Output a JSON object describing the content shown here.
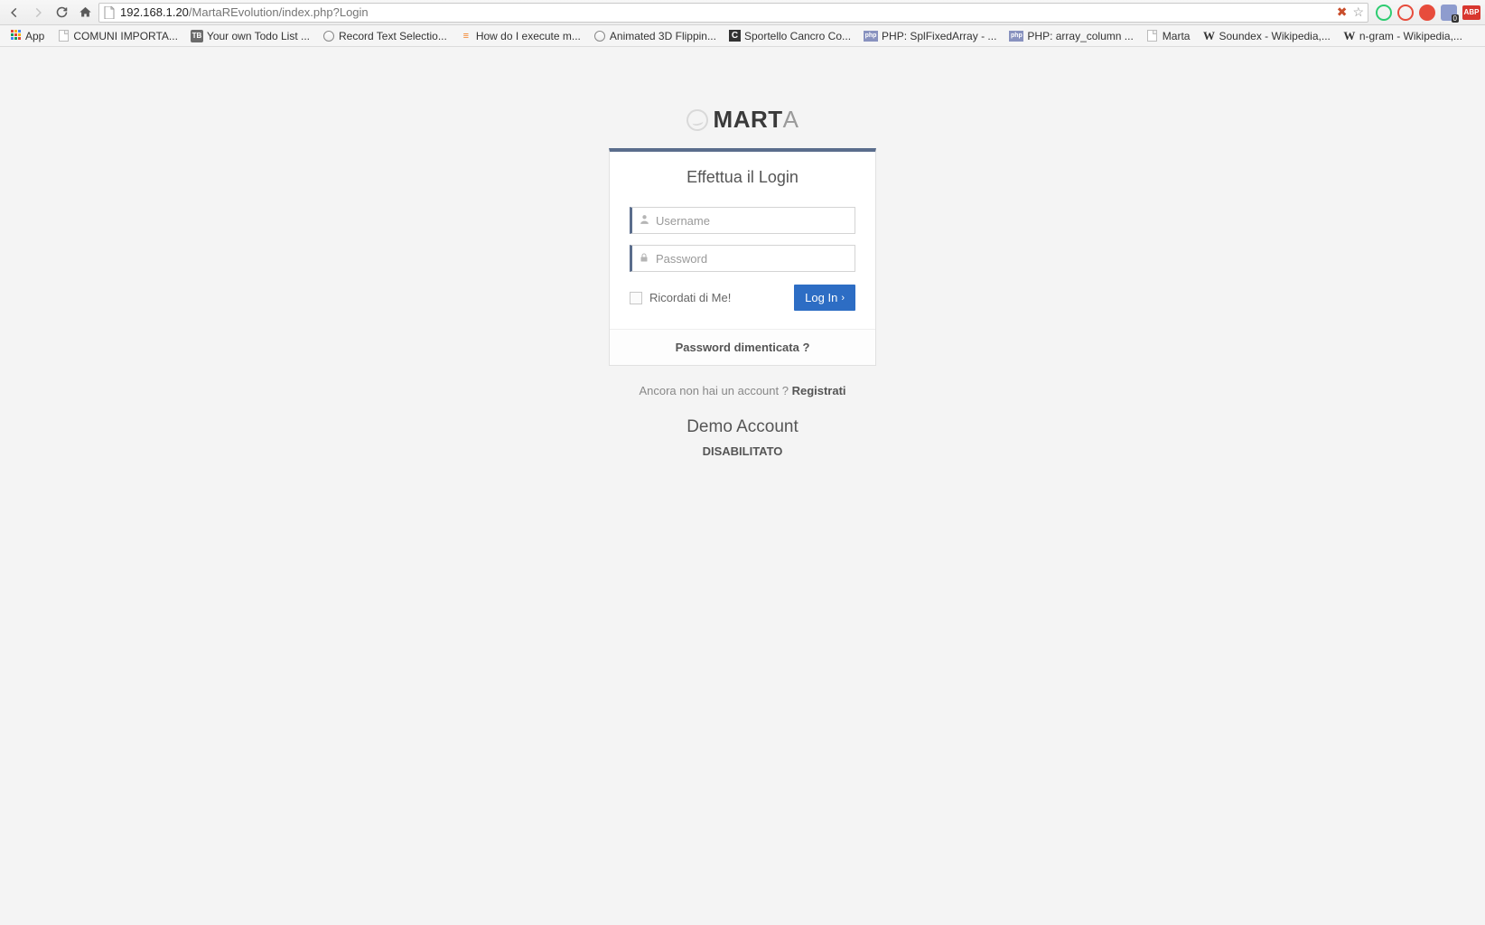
{
  "browser": {
    "url_host": "192.168.1.20",
    "url_path": "/MartaREvolution/index.php?Login"
  },
  "bookmarks": {
    "apps": "App",
    "items": [
      "COMUNI IMPORTA...",
      "Your own Todo List ...",
      "Record Text Selectio...",
      "How do I execute m...",
      "Animated 3D Flippin...",
      "Sportello Cancro Co...",
      "PHP: SplFixedArray - ...",
      "PHP: array_column ...",
      "Marta",
      "Soundex - Wikipedia,...",
      "n-gram - Wikipedia,..."
    ]
  },
  "logo": {
    "bold": "MART",
    "thin": "A"
  },
  "login": {
    "title": "Effettua il Login",
    "username_placeholder": "Username",
    "password_placeholder": "Password",
    "remember_label": "Ricordati di Me!",
    "button_label": "Log In",
    "forgot_label": "Password dimenticata ?"
  },
  "register": {
    "prompt": "Ancora non hai un account ? ",
    "link": "Registrati"
  },
  "demo": {
    "title": "Demo Account",
    "status": "DISABILITATO"
  },
  "ext": {
    "abp": "ABP"
  }
}
